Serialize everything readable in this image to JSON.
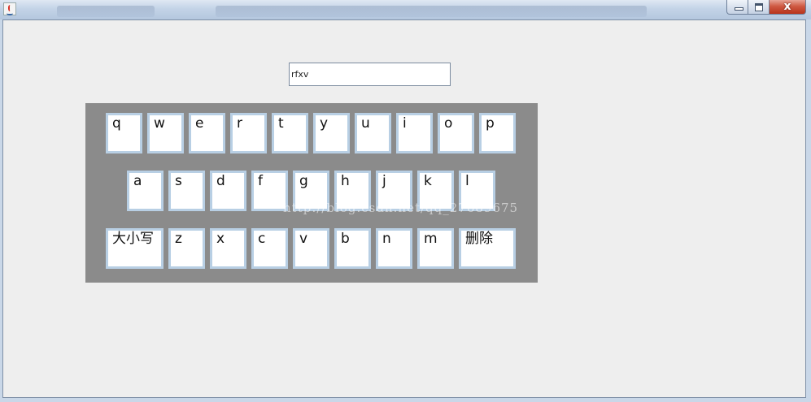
{
  "window": {
    "title": "",
    "close_glyph": "x"
  },
  "input": {
    "value": "rfxv"
  },
  "keyboard": {
    "row1": [
      "q",
      "w",
      "e",
      "r",
      "t",
      "y",
      "u",
      "i",
      "o",
      "p"
    ],
    "row2": [
      "a",
      "s",
      "d",
      "f",
      "g",
      "h",
      "j",
      "k",
      "l"
    ],
    "row3": [
      "大小写",
      "z",
      "x",
      "c",
      "v",
      "b",
      "n",
      "m",
      "删除"
    ]
  },
  "watermark": "http://blog.csdn.net/qq_27689675",
  "colors": {
    "keyboard_background": "#8b8b8b",
    "key_border": "#b8cfe4",
    "window_background": "#eeeeee"
  }
}
